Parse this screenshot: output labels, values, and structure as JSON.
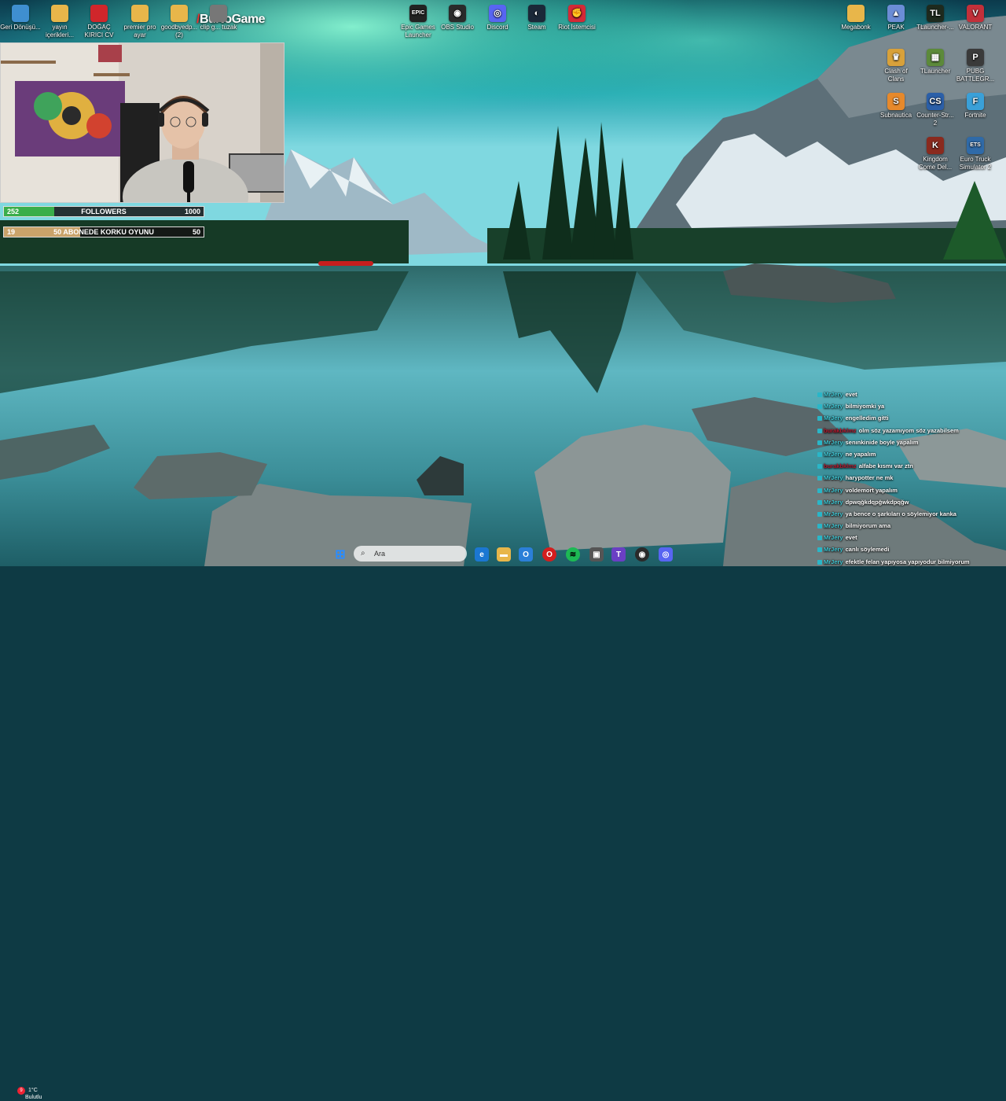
{
  "brand": {
    "prefix": "/",
    "name": "BuNoGame"
  },
  "desktop_icons_left": [
    {
      "label": "Geri Dönüşü...",
      "icon": "recycle-bin-icon",
      "color": "#3f8fd0"
    },
    {
      "label": "yayın içerikleri...",
      "icon": "folder-icon",
      "color": "#e8b64a"
    },
    {
      "label": "DOĞAÇ KIRICI CV",
      "icon": "pdf-icon",
      "color": "#d0262b"
    },
    {
      "label": "premier pro ayar",
      "icon": "folder-icon",
      "color": "#e8b64a"
    },
    {
      "label": "goodbyedp... (2)",
      "icon": "folder-icon",
      "color": "#e8b64a"
    },
    {
      "label": "clip g... tuzak",
      "icon": "file-icon",
      "color": "#777777"
    }
  ],
  "desktop_icons_center": [
    {
      "label": "Epic Games Launcher",
      "icon": "epic-games-icon",
      "color": "#222222",
      "glyph": "EPIC"
    },
    {
      "label": "OBS Studio",
      "icon": "obs-icon",
      "color": "#2a2a2a",
      "glyph": "◉"
    },
    {
      "label": "Discord",
      "icon": "discord-icon",
      "color": "#5865f2",
      "glyph": "◎"
    },
    {
      "label": "Steam",
      "icon": "steam-icon",
      "color": "#1b2838",
      "glyph": "◐"
    },
    {
      "label": "Riot İstemcisi",
      "icon": "riot-icon",
      "color": "#d32936",
      "glyph": "✊"
    }
  ],
  "desktop_icons_right_top": [
    {
      "label": "Megabonk",
      "icon": "folder-icon",
      "color": "#e8b64a",
      "glyph": ""
    },
    {
      "label": "PEAK",
      "icon": "peak-icon",
      "color": "#6b8dd6",
      "glyph": "▲"
    },
    {
      "label": "TLauncher-...",
      "icon": "tlauncher-icon",
      "color": "#1e2a1e",
      "glyph": "TL"
    },
    {
      "label": "VALORANT",
      "icon": "valorant-icon",
      "color": "#c2303a",
      "glyph": "V"
    }
  ],
  "desktop_icons_right_grid": [
    {
      "label": "Clash of Clans",
      "icon": "clash-of-clans-icon",
      "color": "#d8a13a",
      "glyph": "♛"
    },
    {
      "label": "TLauncher",
      "icon": "minecraft-icon",
      "color": "#5c8a3a",
      "glyph": "▦"
    },
    {
      "label": "PUBG BATTLEGR...",
      "icon": "pubg-icon",
      "color": "#3a3a3a",
      "glyph": "P"
    },
    {
      "label": "Subnautica",
      "icon": "subnautica-icon",
      "color": "#e7892b",
      "glyph": "S"
    },
    {
      "label": "Counter-Str... 2",
      "icon": "counter-strike-icon",
      "color": "#2b5fa8",
      "glyph": "CS"
    },
    {
      "label": "Fortnite",
      "icon": "fortnite-icon",
      "color": "#3aa0d8",
      "glyph": "F"
    },
    {
      "label": "Kingdom Come Del...",
      "icon": "kingdom-come-icon",
      "color": "#8a2a1e",
      "glyph": "K"
    },
    {
      "label": "Euro Truck Simulator 2",
      "icon": "euro-truck-icon",
      "color": "#2f6aa8",
      "glyph": "ETS"
    }
  ],
  "followers_goal": {
    "current": "252",
    "title": "FOLLOWERS",
    "goal": "1000",
    "progress": 0.252,
    "fill_color": "#3aae4a"
  },
  "subs_goal": {
    "current": "19",
    "title": "50 ABONEDE KORKU OYUNU",
    "goal": "50",
    "progress": 0.38,
    "fill_color": "#c9a36a"
  },
  "chat": [
    {
      "user": "MrJery",
      "text": "evet",
      "user_color": "cyan"
    },
    {
      "user": "MrJery",
      "text": "bilmiyomki ya",
      "user_color": "cyan"
    },
    {
      "user": "MrJery",
      "text": "engelledim gitti",
      "user_color": "cyan"
    },
    {
      "user": "burakbklmz",
      "text": "olm söz yazamıyom söz yazabilsem",
      "user_color": "red"
    },
    {
      "user": "MrJery",
      "text": "senınkinide boyle yapalım",
      "user_color": "cyan"
    },
    {
      "user": "MrJery",
      "text": "ne yapalım",
      "user_color": "cyan"
    },
    {
      "user": "burakbklmz",
      "text": "alfabe kısmı var ztn",
      "user_color": "red"
    },
    {
      "user": "MrJery",
      "text": "harypotter ne mk",
      "user_color": "cyan"
    },
    {
      "user": "MrJery",
      "text": "voldemort yapalım",
      "user_color": "cyan"
    },
    {
      "user": "MrJery",
      "text": "dpwqğkdqpğwkdpqğw",
      "user_color": "cyan"
    },
    {
      "user": "MrJery",
      "text": "ya bence o şarkıları o söylemiyor kanka",
      "user_color": "cyan"
    },
    {
      "user": "MrJery",
      "text": "bilmiyorum ama",
      "user_color": "cyan"
    },
    {
      "user": "MrJery",
      "text": "evet",
      "user_color": "cyan"
    },
    {
      "user": "MrJery",
      "text": "canlı söylemedi",
      "user_color": "cyan"
    },
    {
      "user": "MrJery",
      "text": "efektle felan yapıyosa yapıyodur bilmiyorum",
      "user_color": "cyan"
    }
  ],
  "taskbar": {
    "search_placeholder": "Ara",
    "weather_temp": "1°C",
    "weather_desc": "Bulutlu",
    "notification_count": "9"
  }
}
